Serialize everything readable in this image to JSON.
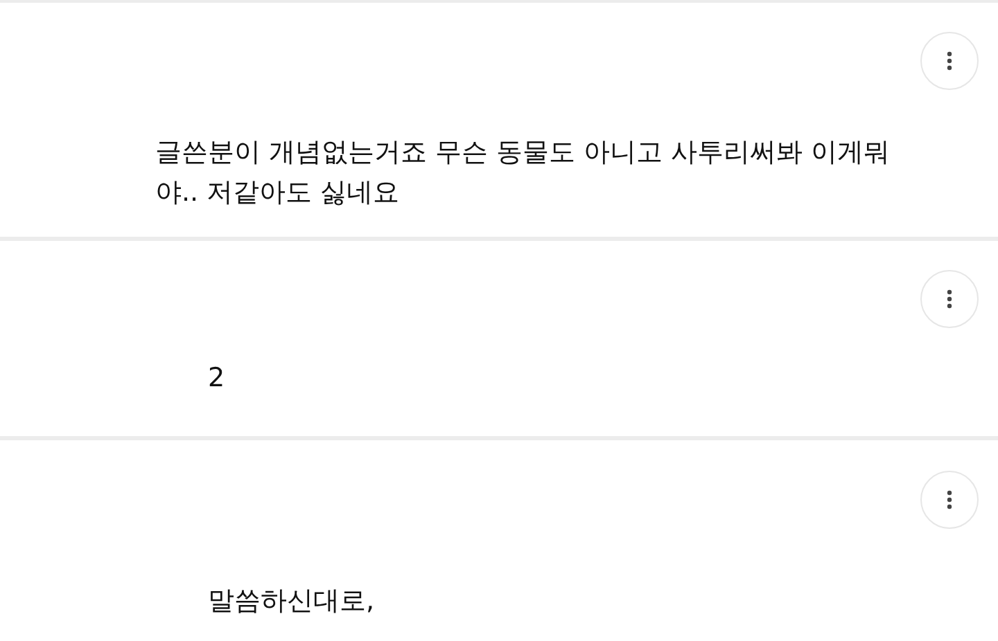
{
  "comments": [
    {
      "kind": "comment",
      "text": "글쓴분이 개념없는거죠 무슨 동물도 아니고 사투리써봐 이게뭐야.. 저같아도 싫네요"
    },
    {
      "kind": "reply",
      "text": "2"
    },
    {
      "kind": "reply",
      "text": "말씀하신대로,"
    }
  ]
}
